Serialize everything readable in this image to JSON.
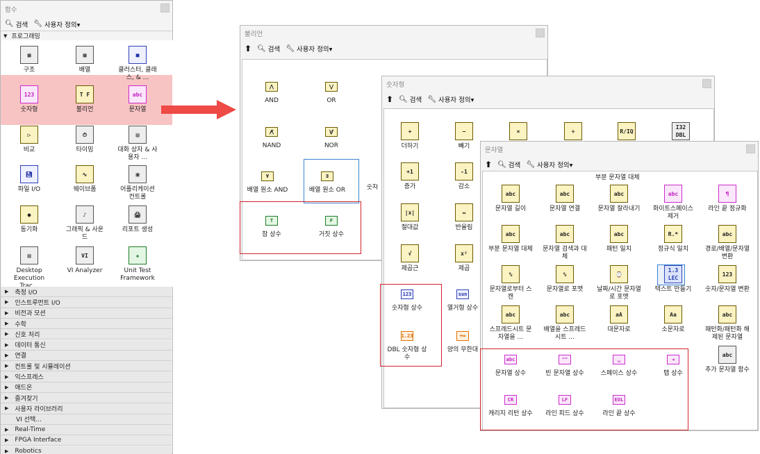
{
  "functions_palette": {
    "title": "함수",
    "search": "검색",
    "customize": "사용자 정의▾",
    "section": "프로그래밍",
    "items": [
      {
        "label": "구조",
        "icon": "structures-icon"
      },
      {
        "label": "배열",
        "icon": "array-icon"
      },
      {
        "label": "클러스터, 클래스, & ...",
        "icon": "cluster-icon"
      },
      {
        "label": "숫자형",
        "icon": "numeric-icon"
      },
      {
        "label": "불리언",
        "icon": "boolean-icon"
      },
      {
        "label": "문자열",
        "icon": "string-icon"
      },
      {
        "label": "비교",
        "icon": "comparison-icon"
      },
      {
        "label": "타이밍",
        "icon": "timing-icon"
      },
      {
        "label": "대화 상자 & 사용자 ...",
        "icon": "dialog-icon"
      },
      {
        "label": "파일 I/O",
        "icon": "file-io-icon"
      },
      {
        "label": "웨이브폼",
        "icon": "waveform-icon"
      },
      {
        "label": "어플리케이션 컨트롤",
        "icon": "application-control-icon"
      },
      {
        "label": "동기화",
        "icon": "synchronization-icon"
      },
      {
        "label": "그래픽 & 사운드",
        "icon": "graphics-sound-icon"
      },
      {
        "label": "리포트 생성",
        "icon": "report-icon"
      },
      {
        "label": "Desktop Execution Trac...",
        "icon": "desktop-trace-icon"
      },
      {
        "label": "VI Analyzer",
        "icon": "vi-analyzer-icon"
      },
      {
        "label": "Unit Test Framework",
        "icon": "unit-test-icon"
      }
    ],
    "categories": [
      {
        "label": "측정 I/O",
        "arrow": true
      },
      {
        "label": "인스트루먼트 I/O",
        "arrow": true
      },
      {
        "label": "비전과 모션",
        "arrow": true
      },
      {
        "label": "수학",
        "arrow": true
      },
      {
        "label": "신호 처리",
        "arrow": true
      },
      {
        "label": "데이터 통신",
        "arrow": true
      },
      {
        "label": "연결",
        "arrow": true
      },
      {
        "label": "컨트롤 및 시뮬레이션",
        "arrow": true
      },
      {
        "label": "익스프레스",
        "arrow": true
      },
      {
        "label": "애드온",
        "arrow": true
      },
      {
        "label": "즐겨찾기",
        "arrow": true
      },
      {
        "label": "사용자 라이브러리",
        "arrow": true
      },
      {
        "label": "VI 선택...",
        "arrow": false
      },
      {
        "label": "Real-Time",
        "arrow": true
      },
      {
        "label": "FPGA Interface",
        "arrow": true
      },
      {
        "label": "Robotics",
        "arrow": true
      }
    ]
  },
  "boolean_palette": {
    "title": "불리언",
    "search": "검색",
    "customize": "사용자 정의▾",
    "items": [
      {
        "label": "AND",
        "icon": "and-icon"
      },
      {
        "label": "OR",
        "icon": "or-icon"
      },
      {
        "label": "NAND",
        "icon": "nand-icon"
      },
      {
        "label": "NOR",
        "icon": "nor-icon"
      },
      {
        "label": "배열 원소 AND",
        "icon": "array-and-icon"
      },
      {
        "label": "배열 원소 OR",
        "icon": "array-or-icon"
      },
      {
        "label": "숫자",
        "icon": ""
      },
      {
        "label": "참 상수",
        "icon": "true-constant-icon",
        "glyph": "T"
      },
      {
        "label": "거짓 상수",
        "icon": "false-constant-icon",
        "glyph": "F"
      }
    ]
  },
  "numeric_palette": {
    "title": "숫자형",
    "search": "검색",
    "customize": "사용자 정의▾",
    "items": [
      {
        "label": "더하기",
        "glyph": "+"
      },
      {
        "label": "빼기",
        "glyph": "−"
      },
      {
        "label": "",
        "glyph": "×"
      },
      {
        "label": "",
        "glyph": "÷"
      },
      {
        "label": "",
        "glyph": "R/IQ"
      },
      {
        "label": "",
        "glyph": "I32 DBL"
      },
      {
        "label": "증가",
        "glyph": "+1"
      },
      {
        "label": "감소",
        "glyph": "-1"
      },
      {
        "label": "절대값",
        "glyph": "|x|"
      },
      {
        "label": "반올림",
        "glyph": "↔"
      },
      {
        "label": "제곱근",
        "glyph": "√"
      },
      {
        "label": "제곱",
        "glyph": "x²"
      },
      {
        "label": "숫자형 상수",
        "glyph": "123"
      },
      {
        "label": "열거형 상수",
        "glyph": "sun"
      },
      {
        "label": "DBL 숫자형 상수",
        "glyph": "1.23"
      },
      {
        "label": "양의 무한대",
        "glyph": "+∞"
      }
    ]
  },
  "string_palette": {
    "title": "문자열",
    "search": "검색",
    "customize": "사용자 정의▾",
    "subheader": "부분 문자열 대체",
    "items": [
      {
        "label": "문자열 길이",
        "glyph": "abc"
      },
      {
        "label": "문자열 연결",
        "glyph": "abc"
      },
      {
        "label": "문자열 잘라내기",
        "glyph": "abc"
      },
      {
        "label": "화이트스페이스 제거",
        "glyph": "abc"
      },
      {
        "label": "라인 끝 정규화",
        "glyph": "¶"
      },
      {
        "label": "부분 문자열 대체",
        "glyph": "abc"
      },
      {
        "label": "문자열 검색과 대체",
        "glyph": "abc"
      },
      {
        "label": "패턴 일치",
        "glyph": "abc"
      },
      {
        "label": "정규식 일치",
        "glyph": "R.*"
      },
      {
        "label": "경로/배열/문자열 변환",
        "glyph": "abc"
      },
      {
        "label": "문자열로부터 스캔",
        "glyph": "%"
      },
      {
        "label": "문자열로 포맷",
        "glyph": "%"
      },
      {
        "label": "날짜/시간 문자열로 포맷",
        "glyph": "⌚"
      },
      {
        "label": "텍스트 만들기",
        "glyph": "1.3 LEC"
      },
      {
        "label": "숫자/문자열 변환",
        "glyph": "123"
      },
      {
        "label": "스프레드시트 문자열을 ...",
        "glyph": "abc"
      },
      {
        "label": "배열을 스프레드시트 ...",
        "glyph": "abc"
      },
      {
        "label": "대문자로",
        "glyph": "aA"
      },
      {
        "label": "소문자로",
        "glyph": "Aa"
      },
      {
        "label": "패턴화/패턴화 해제된 문자열",
        "glyph": "abc"
      },
      {
        "label": "문자열 상수",
        "glyph": "abc"
      },
      {
        "label": "빈 문자열 상수",
        "glyph": "\"\""
      },
      {
        "label": "스페이스 상수",
        "glyph": "␣"
      },
      {
        "label": "탭 상수",
        "glyph": "⇥"
      },
      {
        "label": "추가 문자열 함수",
        "glyph": "abc"
      },
      {
        "label": "캐리지 리턴 상수",
        "glyph": "CR"
      },
      {
        "label": "라인 피드 상수",
        "glyph": "LF"
      },
      {
        "label": "라인 끝 상수",
        "glyph": "EOL"
      }
    ]
  }
}
